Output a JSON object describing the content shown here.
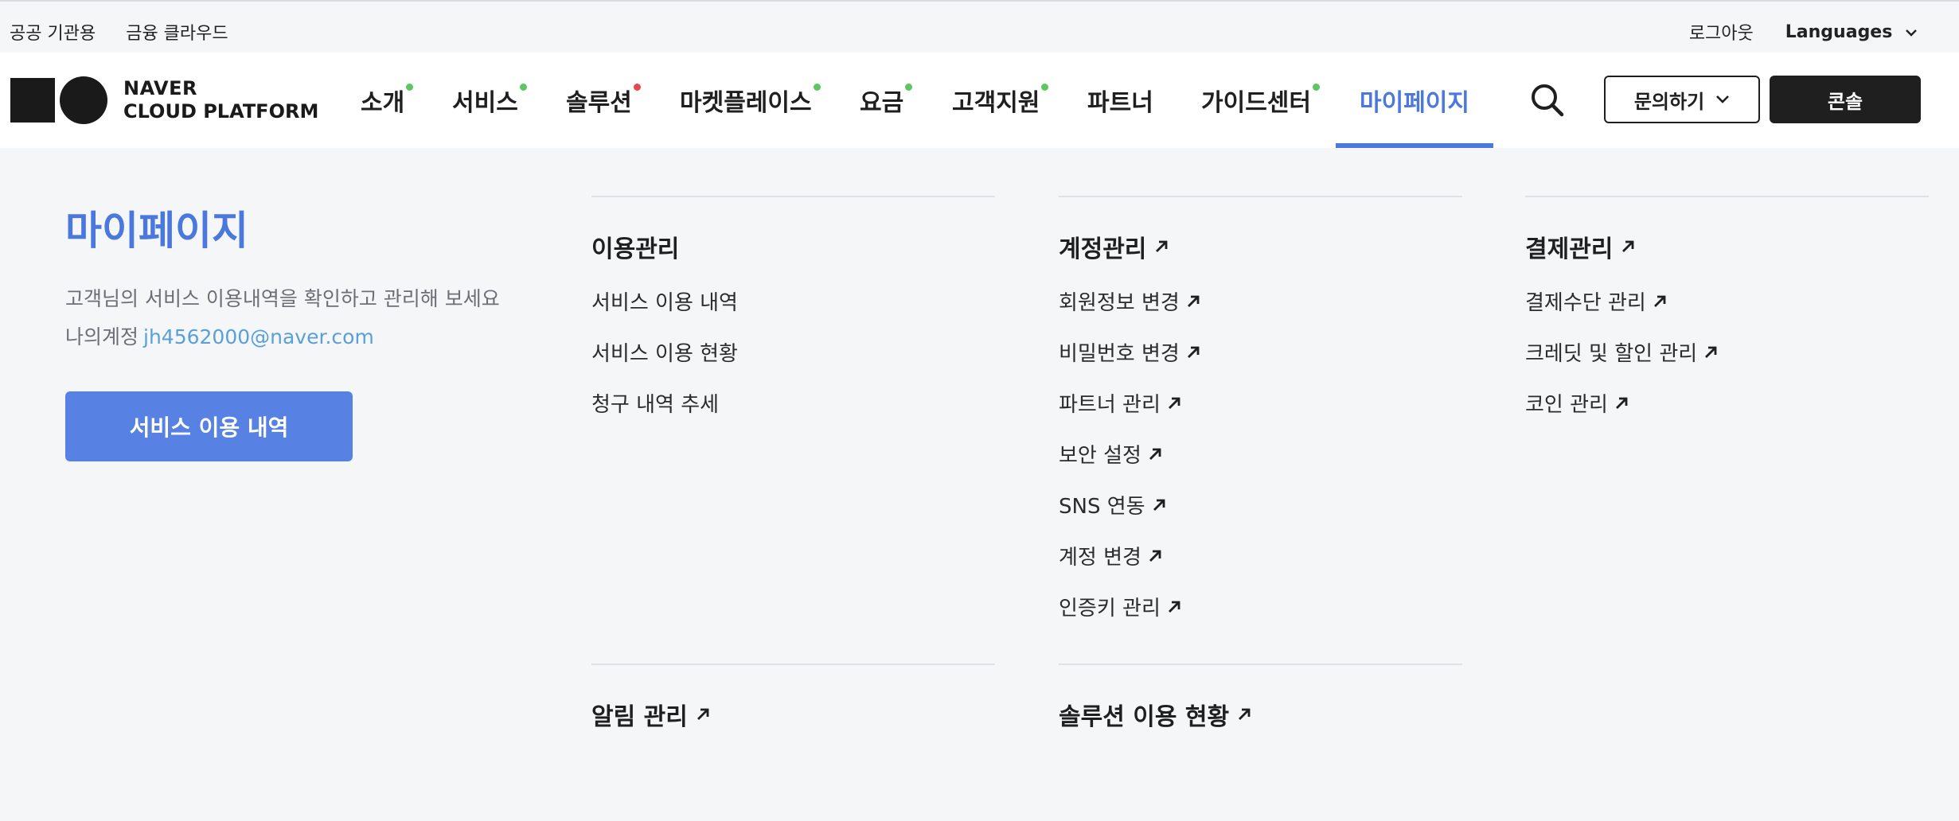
{
  "util": {
    "left_links": [
      "공공 기관용",
      "금융 클라우드"
    ],
    "logout": "로그아웃",
    "languages": "Languages"
  },
  "logo": {
    "line1": "NAVER",
    "line2": "CLOUD PLATFORM"
  },
  "nav": {
    "items": [
      {
        "label": "소개"
      },
      {
        "label": "서비스"
      },
      {
        "label": "솔루션"
      },
      {
        "label": "마켓플레이스"
      },
      {
        "label": "요금"
      },
      {
        "label": "고객지원"
      },
      {
        "label": "파트너"
      },
      {
        "label": "가이드센터"
      },
      {
        "label": "마이페이지"
      }
    ],
    "inquiry": "문의하기",
    "console": "콘솔"
  },
  "intro": {
    "title": "마이페이지",
    "desc": "고객님의 서비스 이용내역을 확인하고 관리해 보세요",
    "account_label": "나의계정",
    "email": "jh4562000@naver.com",
    "button": "서비스 이용 내역"
  },
  "groups": {
    "usage": {
      "title": "이용관리",
      "items": [
        "서비스 이용 내역",
        "서비스 이용 현황",
        "청구 내역 추세"
      ]
    },
    "account": {
      "title": "계정관리",
      "items": [
        "회원정보 변경",
        "비밀번호 변경",
        "파트너 관리",
        "보안 설정",
        "SNS 연동",
        "계정 변경",
        "인증키 관리"
      ]
    },
    "payment": {
      "title": "결제관리",
      "items": [
        "결제수단 관리",
        "크레딧 및 할인 관리",
        "코인 관리"
      ]
    },
    "notification": {
      "title": "알림 관리"
    },
    "solution": {
      "title": "솔루션 이용 현황"
    }
  },
  "colors": {
    "accent": "#4a78dc",
    "button_blue": "#5782e3",
    "dot_green": "#5cc65f",
    "dot_red": "#e9474f",
    "email": "#5aa0d8"
  }
}
